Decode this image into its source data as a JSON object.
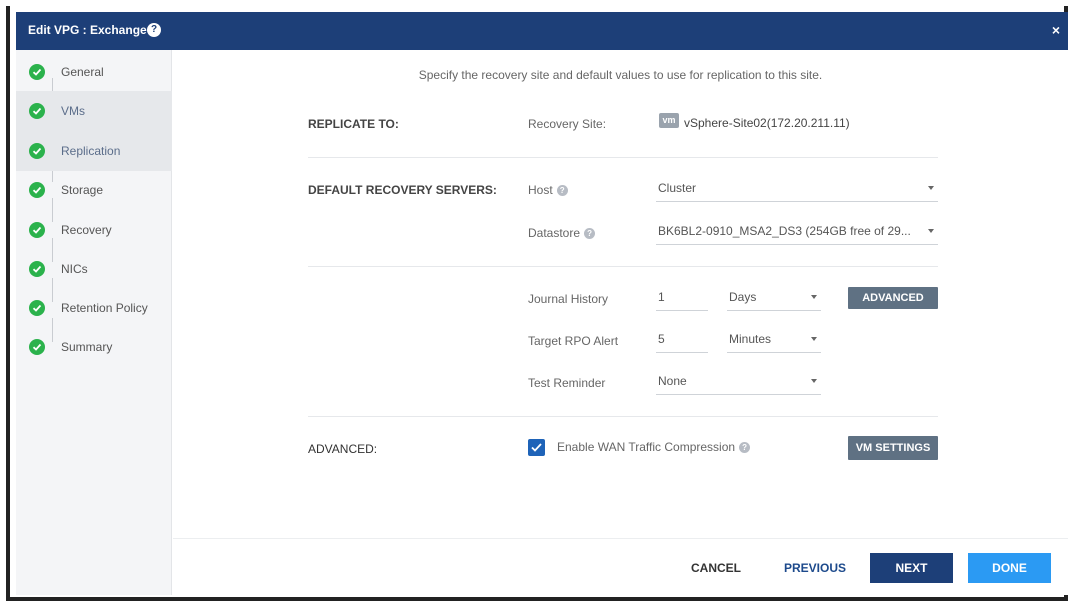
{
  "dialog": {
    "title": "Edit VPG : Exchange",
    "help_glyph": "?",
    "close_glyph": "×"
  },
  "sidebar": {
    "steps": [
      {
        "label": "General"
      },
      {
        "label": "VMs"
      },
      {
        "label": "Replication"
      },
      {
        "label": "Storage"
      },
      {
        "label": "Recovery"
      },
      {
        "label": "NICs"
      },
      {
        "label": "Retention Policy"
      },
      {
        "label": "Summary"
      }
    ],
    "active_step": "Replication",
    "check_color": "#2bb24c"
  },
  "main": {
    "intro": "Specify the recovery site and default values to use for replication to this site.",
    "replicate_to": {
      "section_label": "REPLICATE TO:",
      "field_label": "Recovery Site:",
      "badge": "vm",
      "value": "vSphere-Site02(172.20.211.11)"
    },
    "default_recovery_servers": {
      "section_label": "DEFAULT RECOVERY SERVERS:",
      "host_label": "Host",
      "host_value": "Cluster",
      "datastore_label": "Datastore",
      "datastore_value": "BK6BL2-0910_MSA2_DS3 (254GB free of 29..."
    },
    "journal": {
      "journal_history_label": "Journal History",
      "journal_history_value": "1",
      "journal_history_unit": "Days",
      "advanced_button": "ADVANCED",
      "target_rpo_label": "Target RPO Alert",
      "target_rpo_value": "5",
      "target_rpo_unit": "Minutes",
      "test_reminder_label": "Test Reminder",
      "test_reminder_value": "None"
    },
    "advanced": {
      "section_label": "ADVANCED:",
      "wan_compression_label": "Enable WAN Traffic Compression",
      "wan_compression_checked": true,
      "vm_settings_button": "VM SETTINGS"
    }
  },
  "footer": {
    "cancel": "CANCEL",
    "previous": "PREVIOUS",
    "next": "NEXT",
    "done": "DONE"
  },
  "colors": {
    "header": "#1d3f78",
    "primary_button": "#1d3f78",
    "done_button": "#2b9af3",
    "secondary_button": "#5f7183",
    "checkbox": "#1e63b8"
  }
}
